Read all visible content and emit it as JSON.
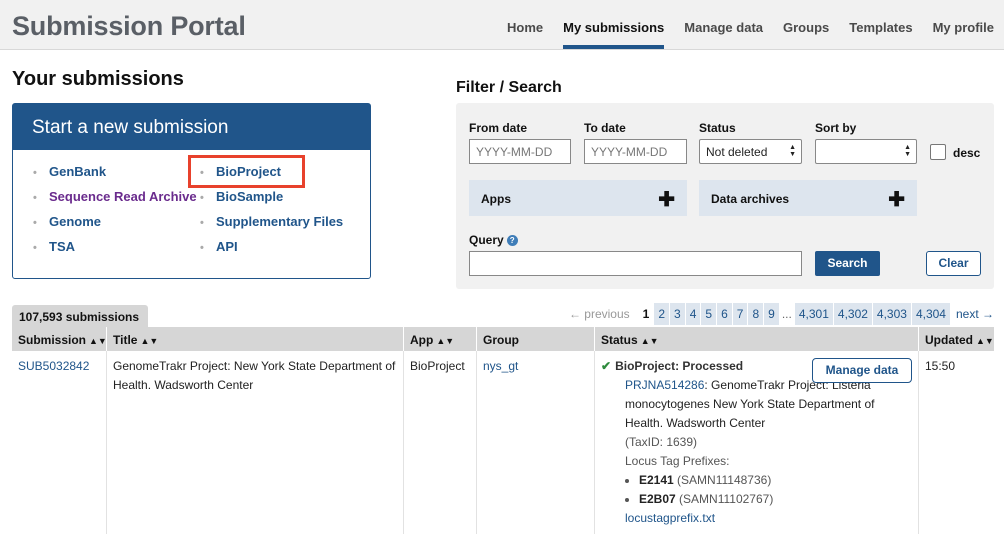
{
  "header": {
    "brand": "Submission Portal",
    "nav": [
      "Home",
      "My submissions",
      "Manage data",
      "Groups",
      "Templates",
      "My profile"
    ],
    "active_nav": "My submissions"
  },
  "page_title": "Your submissions",
  "start": {
    "title": "Start a new submission",
    "col1": [
      "GenBank",
      "Sequence Read Archive",
      "Genome",
      "TSA"
    ],
    "col2": [
      "BioProject",
      "BioSample",
      "Supplementary Files",
      "API"
    ],
    "highlighted": "BioProject"
  },
  "filter": {
    "title": "Filter / Search",
    "from_label": "From date",
    "from_placeholder": "YYYY-MM-DD",
    "to_label": "To date",
    "to_placeholder": "YYYY-MM-DD",
    "status_label": "Status",
    "status_value": "Not deleted",
    "sort_label": "Sort by",
    "sort_value": "",
    "desc_label": "desc",
    "apps_label": "Apps",
    "archives_label": "Data archives",
    "query_label": "Query",
    "search_label": "Search",
    "clear_label": "Clear"
  },
  "count": "107,593 submissions",
  "pager": {
    "prev": "← previous",
    "current": "1",
    "pages_a": [
      "2",
      "3",
      "4",
      "5",
      "6",
      "7",
      "8",
      "9"
    ],
    "ellipsis": "...",
    "pages_b": [
      "4,301",
      "4,302",
      "4,303",
      "4,304"
    ],
    "next": "next →"
  },
  "table": {
    "headers": [
      "Submission",
      "Title",
      "App",
      "Group",
      "Status",
      "Updated"
    ],
    "row": {
      "submission": "SUB5032842",
      "title": "GenomeTrakr Project: New York State Department of Health. Wadsworth Center",
      "app": "BioProject",
      "group": "nys_gt",
      "status_app": "BioProject:",
      "status_value": "Processed",
      "manage_label": "Manage data",
      "accession": "PRJNA514286",
      "accession_desc": ": GenomeTrakr Project: Listeria monocytogenes New York State Department of Health. Wadsworth Center",
      "taxid": "(TaxID: 1639)",
      "locus_label": "Locus Tag Prefixes:",
      "prefixes": [
        {
          "code": "E2141",
          "sample": "(SAMN11148736)"
        },
        {
          "code": "E2B07",
          "sample": "(SAMN11102767)"
        }
      ],
      "file": "locustagprefix.txt",
      "updated": "15:50"
    }
  },
  "colors": {
    "brand_blue": "#20558a",
    "highlight": "#e8412c",
    "success": "#2e8b3d"
  }
}
